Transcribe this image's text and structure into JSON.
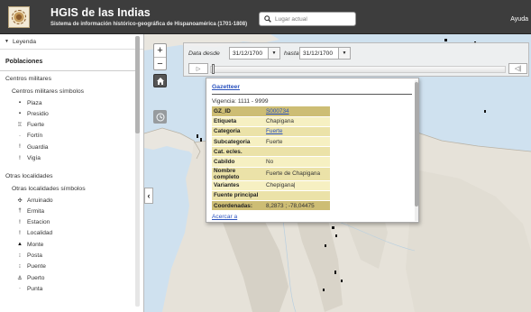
{
  "header": {
    "title": "HGIS de las Indias",
    "subtitle": "Sistema de información histórico-geográfica de Hispanoamérica (1701-1808)",
    "search_placeholder": "Lugar actual",
    "help": "Ayuda"
  },
  "sidebar": {
    "legend_label": "Leyenda",
    "section_title": "Poblaciones",
    "group1": {
      "title": "Centros militares",
      "sub_title": "Centros militares símbolos",
      "items": [
        {
          "label": "Plaza",
          "icon": "plaza-icon",
          "symbol": "▪"
        },
        {
          "label": "Presidio",
          "icon": "presidio-icon",
          "symbol": "▪"
        },
        {
          "label": "Fuerte",
          "icon": "fuerte-icon",
          "symbol": "♖"
        },
        {
          "label": "Fortín",
          "icon": "fortin-icon",
          "symbol": "·"
        },
        {
          "label": "Guardia",
          "icon": "guardia-icon",
          "symbol": "ǃ"
        },
        {
          "label": "Vigía",
          "icon": "vigia-icon",
          "symbol": "ǃ"
        }
      ]
    },
    "group2": {
      "title": "Otras localidades",
      "sub_title": "Otras localidades símbolos",
      "items": [
        {
          "label": "Arruinado",
          "icon": "arruinado-icon",
          "symbol": "✣"
        },
        {
          "label": "Ermita",
          "icon": "ermita-icon",
          "symbol": "†"
        },
        {
          "label": "Estacion",
          "icon": "estacion-icon",
          "symbol": "ǃ"
        },
        {
          "label": "Localidad",
          "icon": "localidad-icon",
          "symbol": "ǃ"
        },
        {
          "label": "Monte",
          "icon": "monte-icon",
          "symbol": "▲"
        },
        {
          "label": "Posta",
          "icon": "posta-icon",
          "symbol": "⁝"
        },
        {
          "label": "Puente",
          "icon": "puente-icon",
          "symbol": "⁝"
        },
        {
          "label": "Puerto",
          "icon": "puerto-icon",
          "symbol": "⚓"
        },
        {
          "label": "Punta",
          "icon": "punta-icon",
          "symbol": "·"
        }
      ]
    }
  },
  "timebar": {
    "from_label": "Data desde",
    "from_date": "31/12/1700",
    "to_label": "hasta",
    "to_date": "31/12/1700"
  },
  "popup": {
    "title": "Gazetteer",
    "vigencia": "Vigencia: 1111 - 9999",
    "rows": [
      {
        "key": "GZ_ID",
        "value": "S000734",
        "link": true
      },
      {
        "key": "Etiqueta",
        "value": "Chapigana"
      },
      {
        "key": "Categoria",
        "value": "Fuerte",
        "link": true
      },
      {
        "key": "Subcategoria",
        "value": "Fuerte"
      },
      {
        "key": "Cat. ecles.",
        "value": ""
      },
      {
        "key": "Cabildo",
        "value": "No"
      },
      {
        "key": "Nombre completo",
        "value": "Fuerte de Chapigana"
      },
      {
        "key": "Variantes",
        "value": "Chepigana|"
      },
      {
        "key": "Fuente principal",
        "value": ""
      },
      {
        "key": "Coordenadas:",
        "value": "8,2873 ; -78,04475"
      }
    ],
    "footer_link": "Acercar a"
  },
  "colors": {
    "header_bg": "#3d3d3d",
    "sea": "#cfe1ef",
    "land": "#e9e6df",
    "popup_row": "#f6f0c2",
    "popup_row_alt": "#ebe2a8",
    "link": "#2a52be"
  }
}
